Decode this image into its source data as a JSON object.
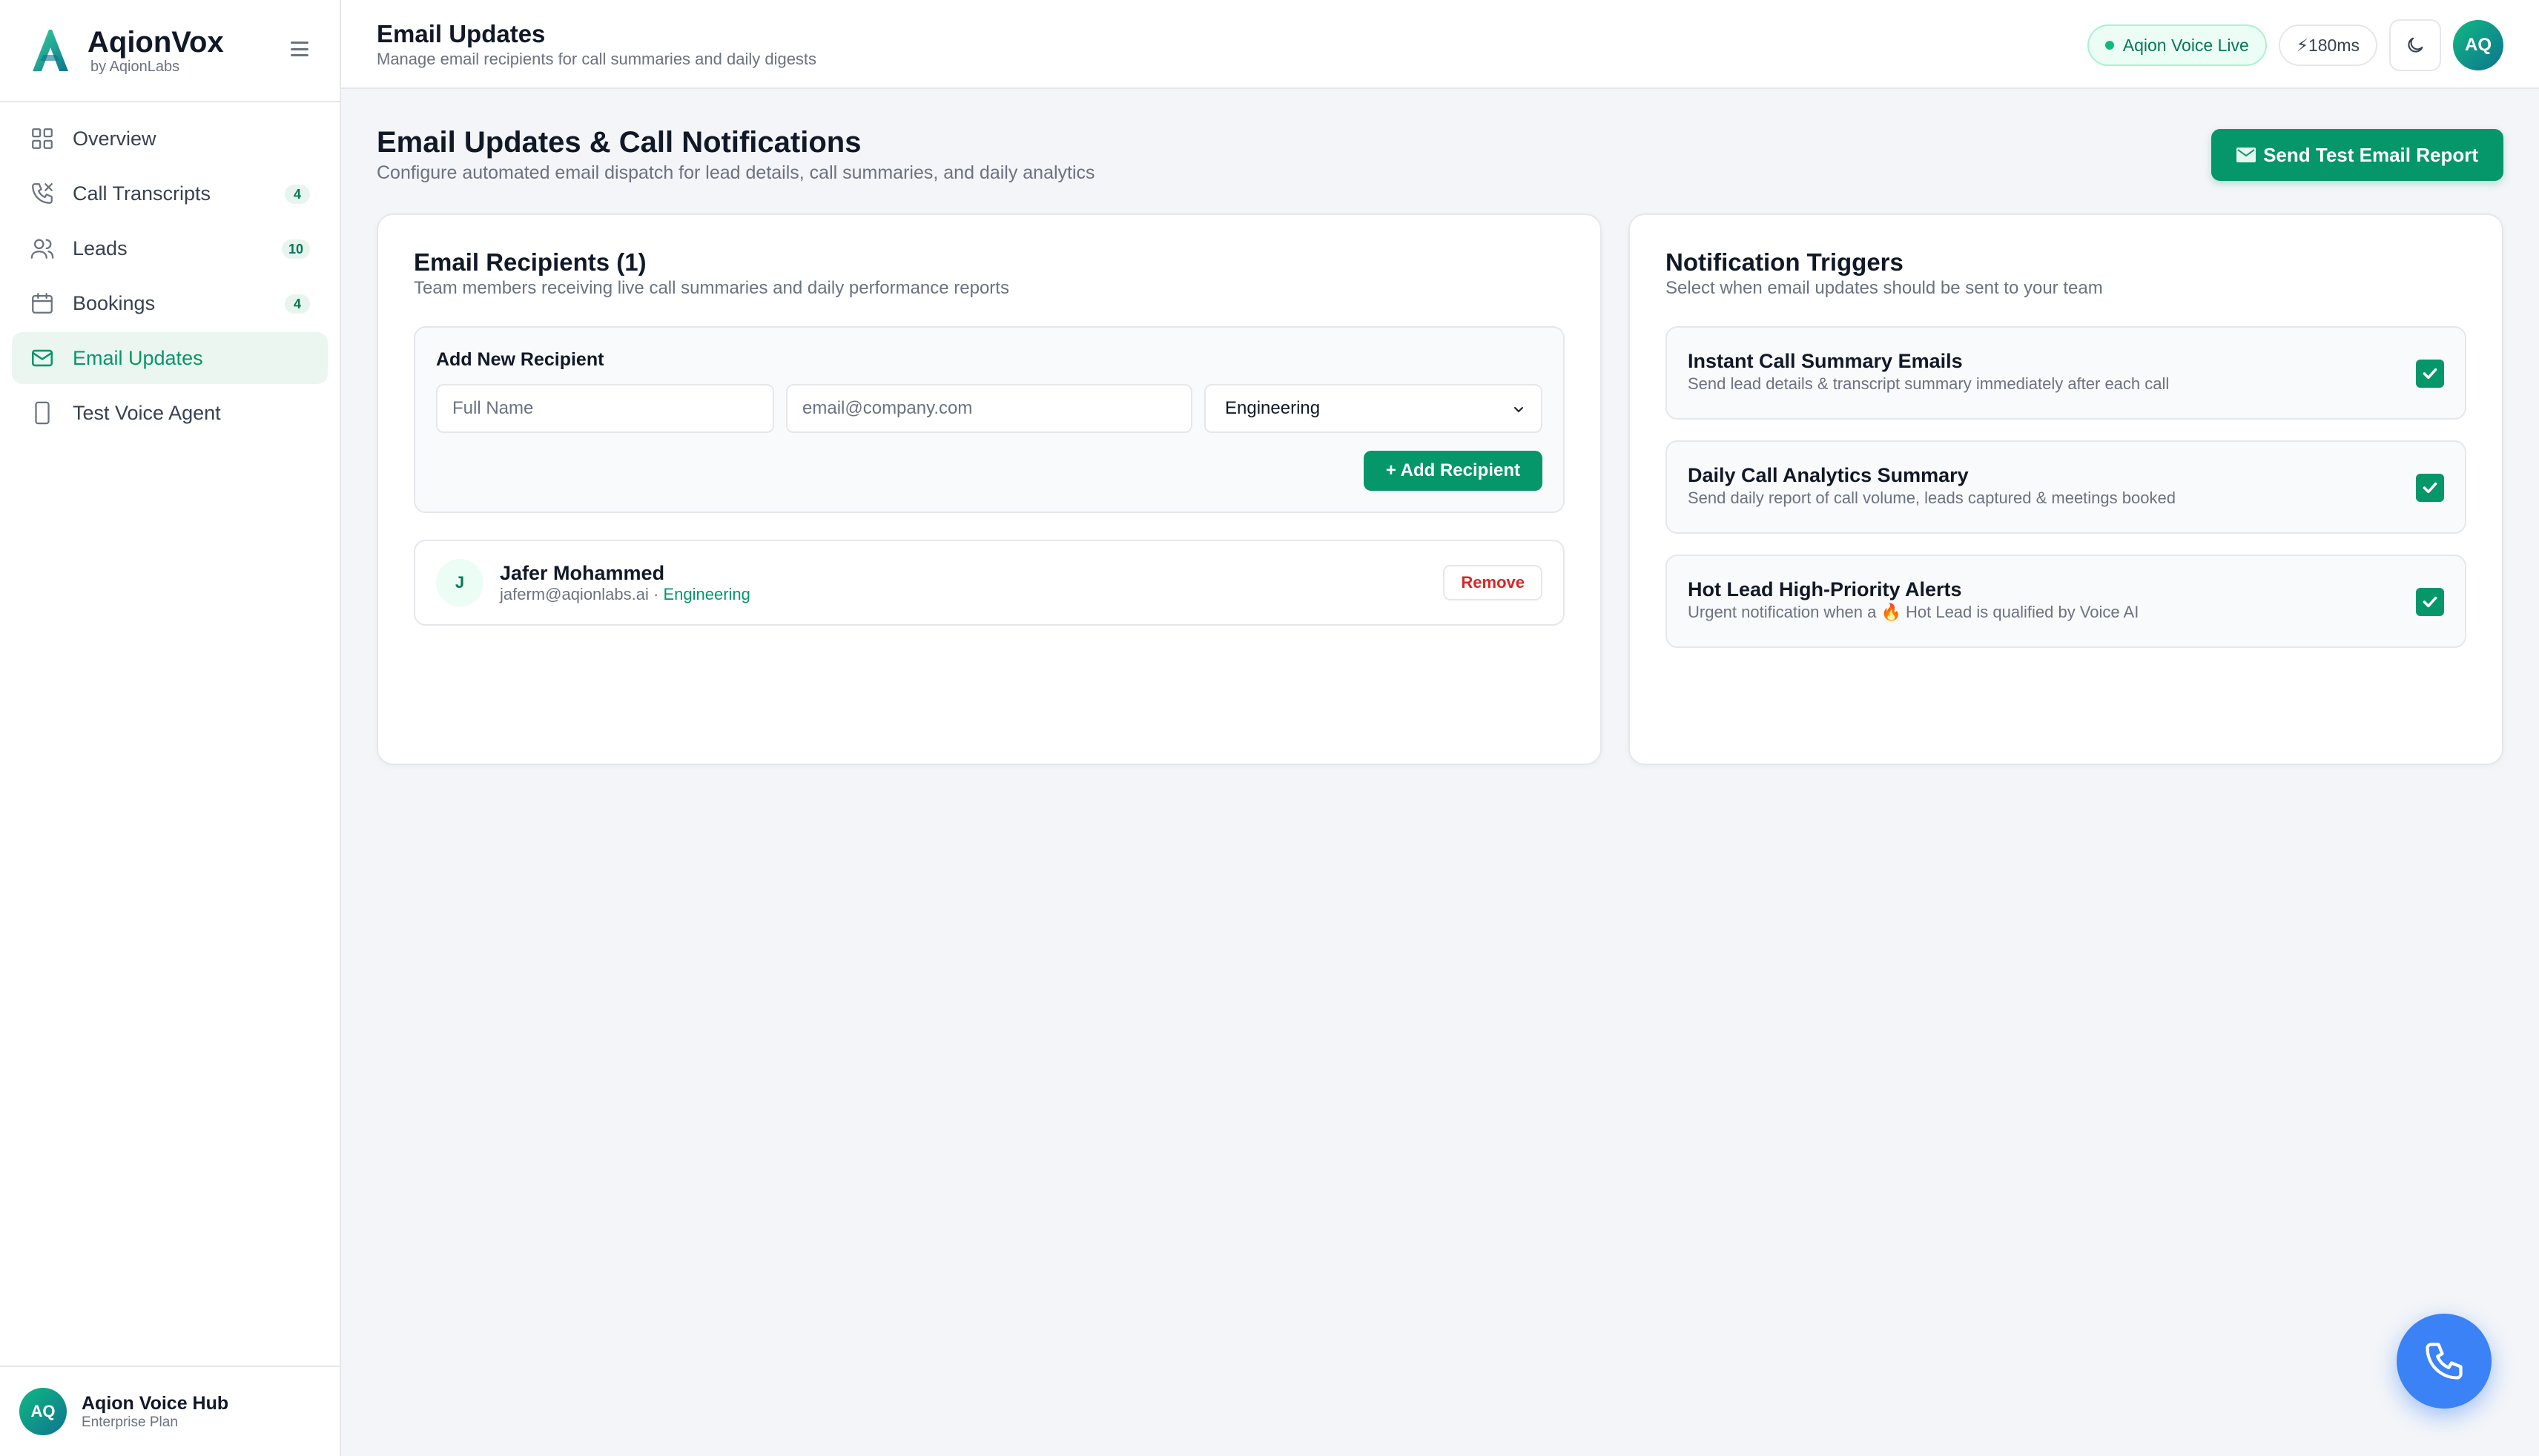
{
  "brand": {
    "name": "AqionVox",
    "sub": "by AqionLabs"
  },
  "nav": {
    "items": [
      {
        "label": "Overview",
        "icon": "grid-icon"
      },
      {
        "label": "Call Transcripts",
        "icon": "phone-icon",
        "badge": "4"
      },
      {
        "label": "Leads",
        "icon": "users-icon",
        "badge": "10"
      },
      {
        "label": "Bookings",
        "icon": "calendar-icon",
        "badge": "4"
      },
      {
        "label": "Email Updates",
        "icon": "mail-icon",
        "active": true
      },
      {
        "label": "Test Voice Agent",
        "icon": "smartphone-icon"
      }
    ]
  },
  "sidebar_footer": {
    "initials": "AQ",
    "title": "Aqion Voice Hub",
    "plan": "Enterprise Plan"
  },
  "topbar": {
    "title": "Email Updates",
    "subtitle": "Manage email recipients for call summaries and daily digests",
    "live_label": "Aqion Voice Live",
    "latency_label": "⚡180ms",
    "avatar_initials": "AQ"
  },
  "page": {
    "title": "Email Updates & Call Notifications",
    "subtitle": "Configure automated email dispatch for lead details, call summaries, and daily analytics",
    "send_test_label": "Send Test Email Report"
  },
  "recipients": {
    "title": "Email Recipients (1)",
    "subtitle": "Team members receiving live call summaries and daily performance reports",
    "add_title": "Add New Recipient",
    "name_placeholder": "Full Name",
    "email_placeholder": "email@company.com",
    "department_selected": "Engineering",
    "add_button": "+ Add Recipient",
    "list": [
      {
        "initial": "J",
        "name": "Jafer Mohammed",
        "email": "jaferm@aqionlabs.ai",
        "separator": " · ",
        "department": "Engineering",
        "remove_label": "Remove"
      }
    ]
  },
  "triggers": {
    "title": "Notification Triggers",
    "subtitle": "Select when email updates should be sent to your team",
    "items": [
      {
        "title": "Instant Call Summary Emails",
        "description": "Send lead details & transcript summary immediately after each call",
        "checked": true
      },
      {
        "title": "Daily Call Analytics Summary",
        "description": "Send daily report of call volume, leads captured & meetings booked",
        "checked": true
      },
      {
        "title": "Hot Lead High-Priority Alerts",
        "description": "Urgent notification when a 🔥 Hot Lead is qualified by Voice AI",
        "checked": true
      }
    ]
  },
  "colors": {
    "accent": "#059669",
    "fab": "#3b82f6",
    "danger": "#dc2626"
  }
}
